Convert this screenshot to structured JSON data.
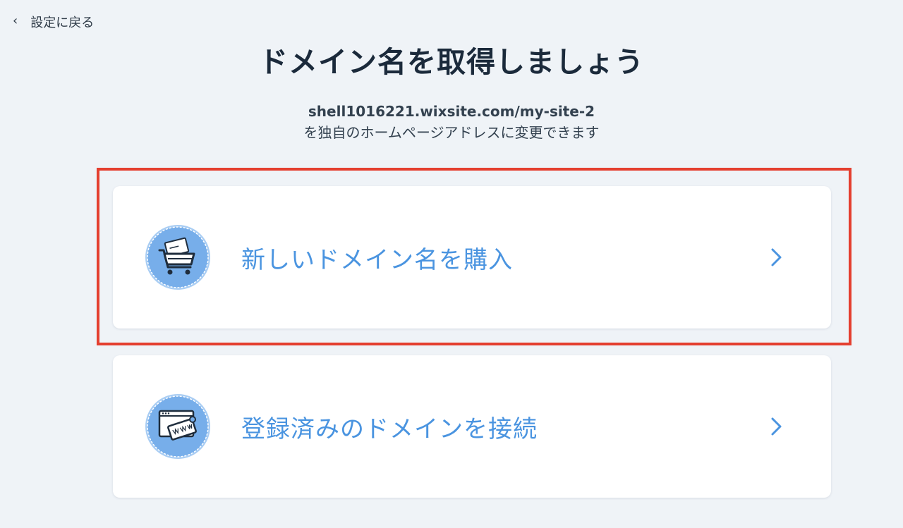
{
  "header": {
    "back_label": "設定に戻る",
    "title": "ドメイン名を取得しましょう"
  },
  "intro": {
    "site_url": "shell1016221.wixsite.com/my-site-2",
    "description": "を独自のホームページアドレスに変更できます"
  },
  "options": [
    {
      "label": "新しいドメイン名を購入",
      "icon": "cart-icon"
    },
    {
      "label": "登録済みのドメインを接続",
      "icon": "browser-www-icon"
    }
  ],
  "colors": {
    "background": "#eff3f7",
    "accent": "#4a94e0",
    "badge": "#77aeea",
    "highlight": "#e43f2f"
  }
}
